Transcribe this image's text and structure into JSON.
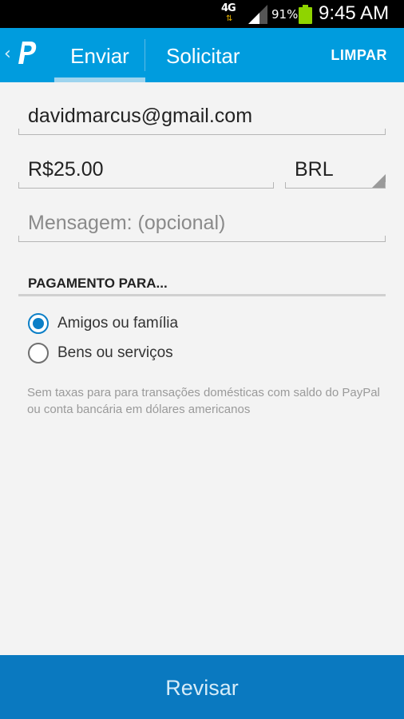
{
  "status_bar": {
    "network": "4G",
    "battery_percent": "91%",
    "time": "9:45 AM"
  },
  "header": {
    "back_glyph": "‹",
    "tabs": [
      {
        "label": "Enviar",
        "active": true
      },
      {
        "label": "Solicitar",
        "active": false
      }
    ],
    "clear_label": "LIMPAR"
  },
  "form": {
    "email_value": "davidmarcus@gmail.com",
    "amount_value": "R$25.00",
    "currency_value": "BRL",
    "message_placeholder": "Mensagem: (opcional)"
  },
  "payment": {
    "title": "PAGAMENTO PARA...",
    "options": [
      {
        "label": "Amigos ou família",
        "selected": true
      },
      {
        "label": "Bens ou serviços",
        "selected": false
      }
    ],
    "note": "Sem taxas para para transações domésticas com saldo do PayPal ou conta bancária em dólares americanos"
  },
  "footer": {
    "review_label": "Revisar"
  },
  "colors": {
    "header_blue": "#009cde",
    "button_blue": "#0a79c0",
    "radio_blue": "#0b7fc7",
    "battery_green": "#8fd400"
  },
  "icons": [
    "network-4g-icon",
    "signal-icon",
    "battery-icon",
    "back-chevron-icon",
    "paypal-logo-icon",
    "dropdown-triangle-icon",
    "radio-checked-icon",
    "radio-unchecked-icon"
  ]
}
